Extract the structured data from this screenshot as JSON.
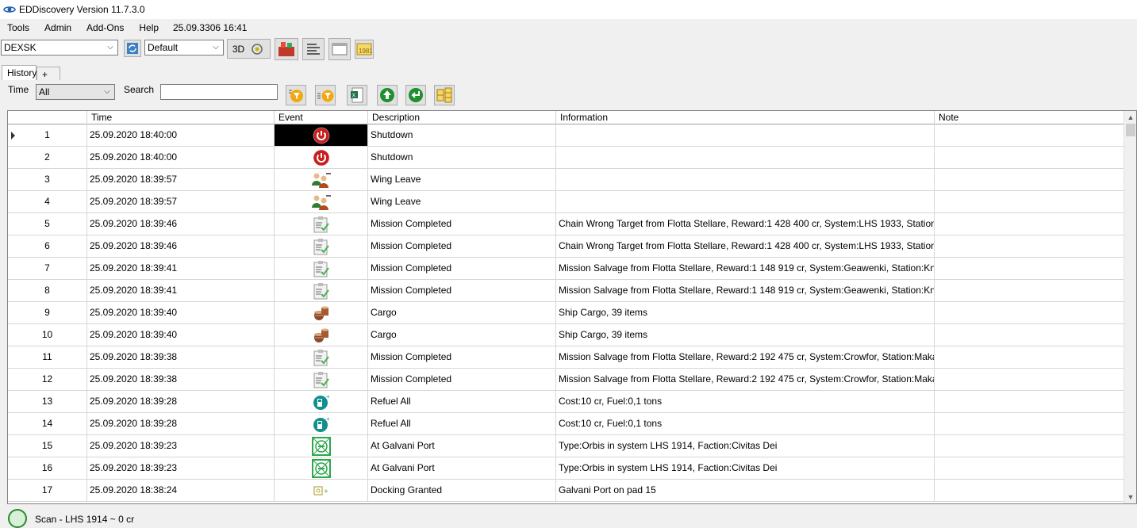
{
  "window": {
    "title": "EDDiscovery Version 11.7.3.0"
  },
  "menu": [
    {
      "label": "Tools"
    },
    {
      "label": "Admin"
    },
    {
      "label": "Add-Ons"
    },
    {
      "label": "Help"
    }
  ],
  "clock": "25.09.3306 16:41",
  "toolbar": {
    "commander": "DEXSK",
    "profile": "Default",
    "btn_3d": "3D"
  },
  "tabs": [
    {
      "label": "History"
    },
    {
      "label": "+"
    }
  ],
  "filters": {
    "time_label": "Time",
    "time_value": "All",
    "search_label": "Search",
    "search_value": ""
  },
  "columns": [
    "",
    "Time",
    "Event",
    "Description",
    "Information",
    "Note"
  ],
  "rows": [
    {
      "n": "1",
      "time": "25.09.2020 18:40:00",
      "icon": "shutdown-icon",
      "desc": "Shutdown",
      "info": "",
      "note": ""
    },
    {
      "n": "2",
      "time": "25.09.2020 18:40:00",
      "icon": "shutdown-icon",
      "desc": "Shutdown",
      "info": "",
      "note": ""
    },
    {
      "n": "3",
      "time": "25.09.2020 18:39:57",
      "icon": "wing-leave-icon",
      "desc": "Wing Leave",
      "info": "",
      "note": ""
    },
    {
      "n": "4",
      "time": "25.09.2020 18:39:57",
      "icon": "wing-leave-icon",
      "desc": "Wing Leave",
      "info": "",
      "note": ""
    },
    {
      "n": "5",
      "time": "25.09.2020 18:39:46",
      "icon": "mission-completed-icon",
      "desc": "Mission Completed",
      "info": "Chain Wrong Target from Flotta Stellare, Reward:1 428 400 cr, System:LHS 1933, Station:Heman...",
      "note": ""
    },
    {
      "n": "6",
      "time": "25.09.2020 18:39:46",
      "icon": "mission-completed-icon",
      "desc": "Mission Completed",
      "info": "Chain Wrong Target from Flotta Stellare, Reward:1 428 400 cr, System:LHS 1933, Station:Heman...",
      "note": ""
    },
    {
      "n": "7",
      "time": "25.09.2020 18:39:41",
      "icon": "mission-completed-icon",
      "desc": "Mission Completed",
      "info": "Mission Salvage from Flotta Stellare, Reward:1 148 919 cr, System:Geawenki, Station:Knapp Vision",
      "note": ""
    },
    {
      "n": "8",
      "time": "25.09.2020 18:39:41",
      "icon": "mission-completed-icon",
      "desc": "Mission Completed",
      "info": "Mission Salvage from Flotta Stellare, Reward:1 148 919 cr, System:Geawenki, Station:Knapp Vision",
      "note": ""
    },
    {
      "n": "9",
      "time": "25.09.2020 18:39:40",
      "icon": "cargo-icon",
      "desc": "Cargo",
      "info": "Ship Cargo, 39 items",
      "note": ""
    },
    {
      "n": "10",
      "time": "25.09.2020 18:39:40",
      "icon": "cargo-icon",
      "desc": "Cargo",
      "info": "Ship Cargo, 39 items",
      "note": ""
    },
    {
      "n": "11",
      "time": "25.09.2020 18:39:38",
      "icon": "mission-completed-icon",
      "desc": "Mission Completed",
      "info": "Mission Salvage from Flotta Stellare, Reward:2 192 475 cr, System:Crowfor, Station:Makarov Ter...",
      "note": ""
    },
    {
      "n": "12",
      "time": "25.09.2020 18:39:38",
      "icon": "mission-completed-icon",
      "desc": "Mission Completed",
      "info": "Mission Salvage from Flotta Stellare, Reward:2 192 475 cr, System:Crowfor, Station:Makarov Ter...",
      "note": ""
    },
    {
      "n": "13",
      "time": "25.09.2020 18:39:28",
      "icon": "refuel-icon",
      "desc": "Refuel All",
      "info": "Cost:10 cr, Fuel:0,1 tons",
      "note": ""
    },
    {
      "n": "14",
      "time": "25.09.2020 18:39:28",
      "icon": "refuel-icon",
      "desc": "Refuel All",
      "info": "Cost:10 cr, Fuel:0,1 tons",
      "note": ""
    },
    {
      "n": "15",
      "time": "25.09.2020 18:39:23",
      "icon": "docked-icon",
      "desc": "At Galvani Port",
      "info": "Type:Orbis in system LHS 1914, Faction:Civitas Dei",
      "note": ""
    },
    {
      "n": "16",
      "time": "25.09.2020 18:39:23",
      "icon": "docked-icon",
      "desc": "At Galvani Port",
      "info": "Type:Orbis in system LHS 1914, Faction:Civitas Dei",
      "note": ""
    },
    {
      "n": "17",
      "time": "25.09.2020 18:38:24",
      "icon": "docking-granted-icon",
      "desc": "Docking Granted",
      "info": "Galvani Port on pad 15",
      "note": ""
    }
  ],
  "status": "Scan - LHS 1914 ~ 0 cr"
}
